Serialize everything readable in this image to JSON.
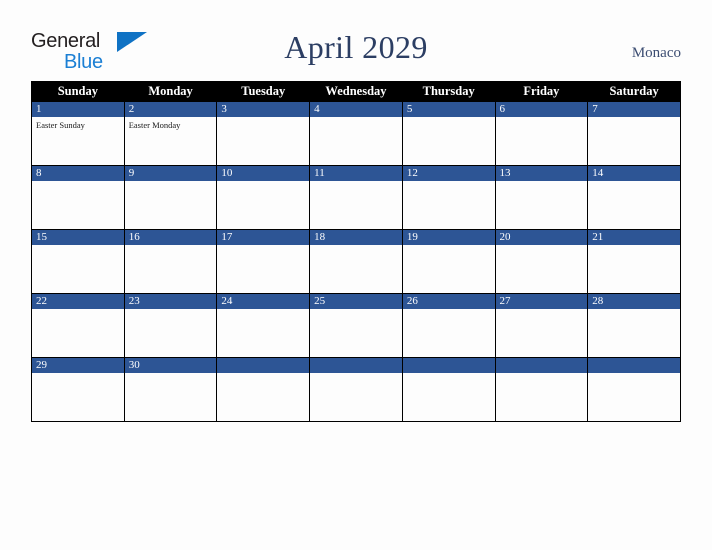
{
  "brand": {
    "logo_text_top": "General",
    "logo_text_bottom": "Blue",
    "color_dark": "#231f20",
    "color_blue": "#1b7fd4"
  },
  "header": {
    "title": "April 2029",
    "country": "Monaco",
    "title_color": "#2c3e63"
  },
  "calendar": {
    "accent_color": "#2d5595",
    "header_bg": "#000000",
    "weekdays": [
      "Sunday",
      "Monday",
      "Tuesday",
      "Wednesday",
      "Thursday",
      "Friday",
      "Saturday"
    ],
    "weeks": [
      [
        {
          "day": "1",
          "events": [
            "Easter Sunday"
          ]
        },
        {
          "day": "2",
          "events": [
            "Easter Monday"
          ]
        },
        {
          "day": "3",
          "events": []
        },
        {
          "day": "4",
          "events": []
        },
        {
          "day": "5",
          "events": []
        },
        {
          "day": "6",
          "events": []
        },
        {
          "day": "7",
          "events": []
        }
      ],
      [
        {
          "day": "8",
          "events": []
        },
        {
          "day": "9",
          "events": []
        },
        {
          "day": "10",
          "events": []
        },
        {
          "day": "11",
          "events": []
        },
        {
          "day": "12",
          "events": []
        },
        {
          "day": "13",
          "events": []
        },
        {
          "day": "14",
          "events": []
        }
      ],
      [
        {
          "day": "15",
          "events": []
        },
        {
          "day": "16",
          "events": []
        },
        {
          "day": "17",
          "events": []
        },
        {
          "day": "18",
          "events": []
        },
        {
          "day": "19",
          "events": []
        },
        {
          "day": "20",
          "events": []
        },
        {
          "day": "21",
          "events": []
        }
      ],
      [
        {
          "day": "22",
          "events": []
        },
        {
          "day": "23",
          "events": []
        },
        {
          "day": "24",
          "events": []
        },
        {
          "day": "25",
          "events": []
        },
        {
          "day": "26",
          "events": []
        },
        {
          "day": "27",
          "events": []
        },
        {
          "day": "28",
          "events": []
        }
      ],
      [
        {
          "day": "29",
          "events": []
        },
        {
          "day": "30",
          "events": []
        },
        {
          "day": "",
          "events": []
        },
        {
          "day": "",
          "events": []
        },
        {
          "day": "",
          "events": []
        },
        {
          "day": "",
          "events": []
        },
        {
          "day": "",
          "events": []
        }
      ]
    ]
  }
}
